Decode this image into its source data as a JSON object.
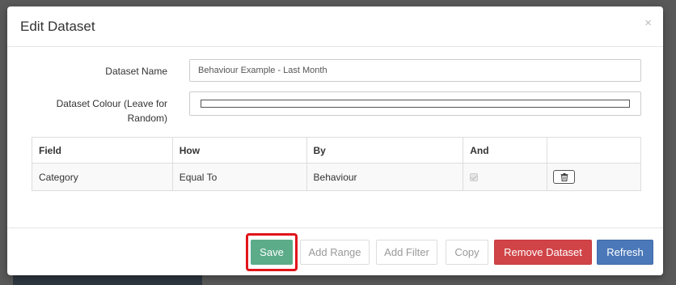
{
  "modal": {
    "title": "Edit Dataset",
    "close_glyph": "×"
  },
  "form": {
    "name_label": "Dataset Name",
    "name_value": "Behaviour Example - Last Month",
    "colour_label": "Dataset Colour (Leave for Random)",
    "colour_value": "#ffffff"
  },
  "table": {
    "headers": [
      "Field",
      "How",
      "By",
      "And",
      ""
    ],
    "rows": [
      {
        "field": "Category",
        "how": "Equal To",
        "by": "Behaviour",
        "and_checked": true,
        "action_icon": "trash-icon"
      }
    ]
  },
  "footer": {
    "save_label": "Save",
    "add_range_label": "Add Range",
    "add_filter_label": "Add Filter",
    "copy_label": "Copy",
    "remove_label": "Remove Dataset",
    "refresh_label": "Refresh"
  },
  "colors": {
    "save": "#5cac8a",
    "remove": "#d04447",
    "refresh": "#4a78b9",
    "highlight": "#e1141b"
  }
}
